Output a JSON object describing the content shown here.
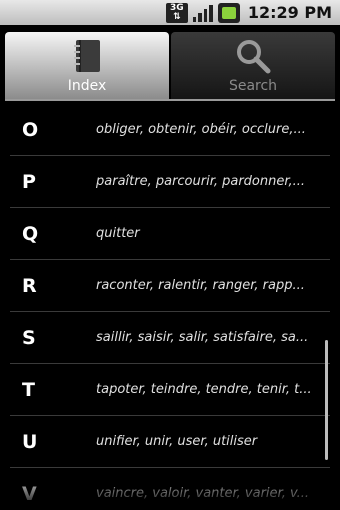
{
  "status_bar": {
    "network": "3G",
    "time": "12:29 PM"
  },
  "tabs": [
    {
      "label": "Index",
      "icon": "notebook-icon",
      "active": true
    },
    {
      "label": "Search",
      "icon": "magnifier-icon",
      "active": false
    }
  ],
  "index": [
    {
      "letter": "O",
      "words": "obliger, obtenir, obéir, occlure,..."
    },
    {
      "letter": "P",
      "words": "paraître, parcourir, pardonner,..."
    },
    {
      "letter": "Q",
      "words": "quitter"
    },
    {
      "letter": "R",
      "words": "raconter, ralentir, ranger, rapp..."
    },
    {
      "letter": "S",
      "words": "saillir, saisir, salir, satisfaire, sa..."
    },
    {
      "letter": "T",
      "words": "tapoter, teindre, tendre, tenir, t..."
    },
    {
      "letter": "U",
      "words": "unifier, unir, user, utiliser"
    },
    {
      "letter": "V",
      "words": "vaincre, valoir, vanter, varier, v..."
    }
  ]
}
